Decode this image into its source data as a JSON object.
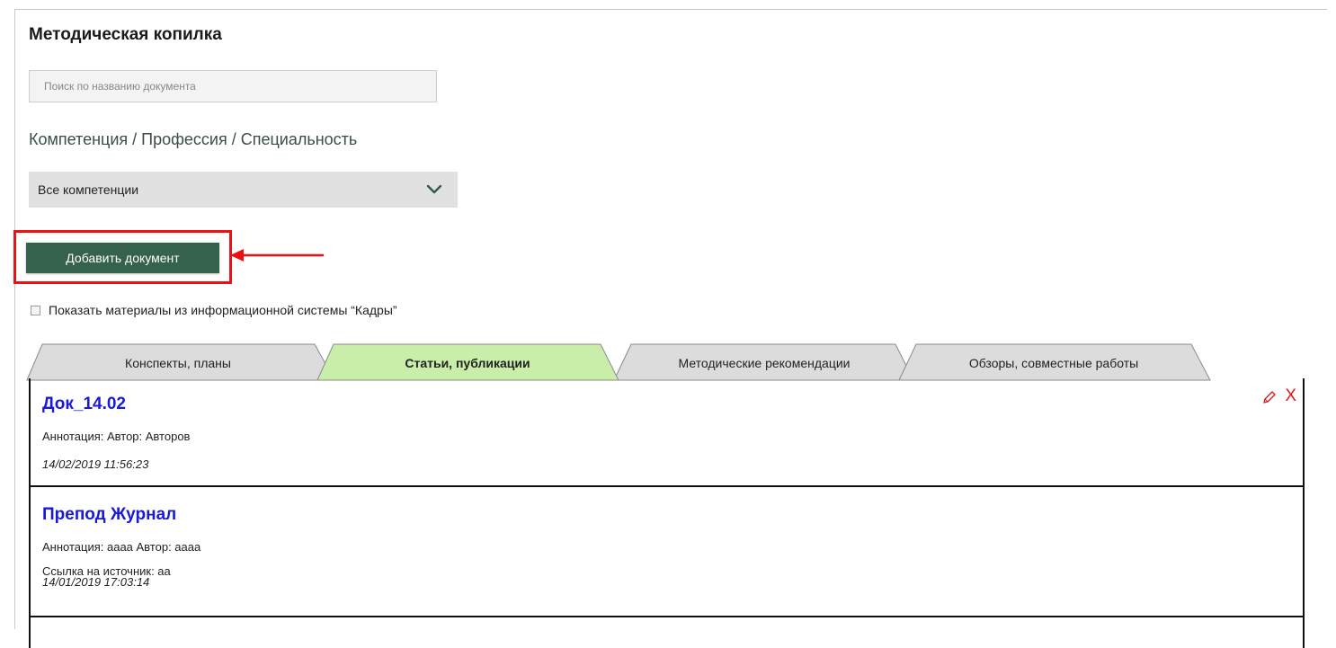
{
  "page": {
    "title": "Методическая копилка"
  },
  "search": {
    "placeholder": "Поиск по названию документа"
  },
  "filter": {
    "label": "Компетенция / Профессия / Специальность",
    "selected": "Все компетенции",
    "icon": "chevron-down-icon"
  },
  "actions": {
    "add_document": "Добавить документ"
  },
  "checkbox": {
    "label": "Показать материалы из информационной системы “Кадры”",
    "checked": false
  },
  "tabs": [
    {
      "label": "Конспекты, планы",
      "active": false
    },
    {
      "label": "Статьи, публикации",
      "active": true
    },
    {
      "label": "Методические рекомендации",
      "active": false
    },
    {
      "label": "Обзоры, совместные работы",
      "active": false
    }
  ],
  "documents": [
    {
      "title": "Док_14.02",
      "annotation": "Аннотация:  Автор:  Авторов",
      "date": "14/02/2019 11:56:23"
    },
    {
      "title": "Препод Журнал",
      "annotation": "Аннотация: аааа Автор:  аааа",
      "source": "Ссылка на источник:  аа",
      "date": "14/01/2019 17:03:14"
    }
  ],
  "icons": {
    "edit": "pencil-icon",
    "delete": "close-icon"
  },
  "colors": {
    "accent_green": "#35624d",
    "active_tab": "#c9eeaa",
    "inactive_tab": "#dcdcdc",
    "link_blue": "#1a1ad6",
    "highlight_red": "#ee1111",
    "delete_red": "#e01a1a"
  }
}
